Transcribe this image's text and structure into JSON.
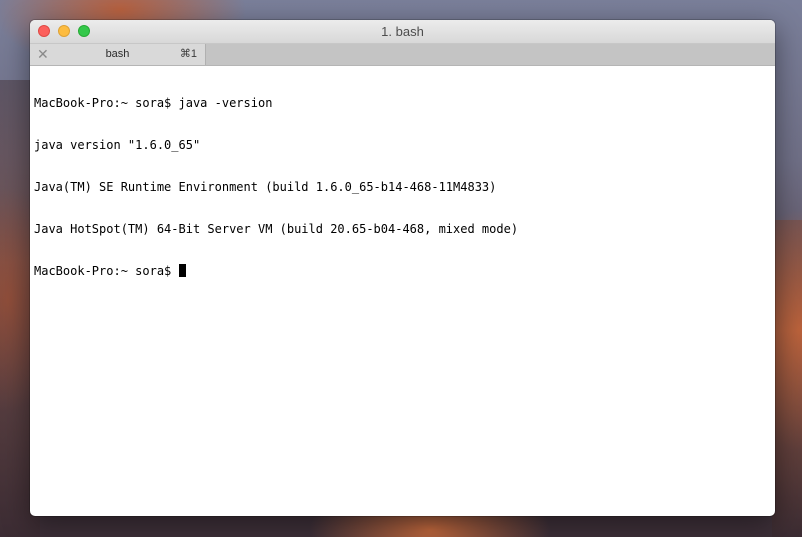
{
  "window": {
    "title": "1. bash"
  },
  "tabs": [
    {
      "label": "bash",
      "shortcut": "⌘1",
      "close_glyph": "✕"
    }
  ],
  "terminal": {
    "lines": [
      "MacBook-Pro:~ sora$ java -version",
      "java version \"1.6.0_65\"",
      "Java(TM) SE Runtime Environment (build 1.6.0_65-b14-468-11M4833)",
      "Java HotSpot(TM) 64-Bit Server VM (build 20.65-b04-468, mixed mode)"
    ],
    "prompt": "MacBook-Pro:~ sora$ "
  },
  "icons": {
    "close": "close-traffic-light",
    "minimize": "minimize-traffic-light",
    "maximize": "zoom-traffic-light",
    "tab_close": "close-icon"
  },
  "colors": {
    "close": "#fc605c",
    "minimize": "#fdbc40",
    "maximize": "#34c84a"
  }
}
